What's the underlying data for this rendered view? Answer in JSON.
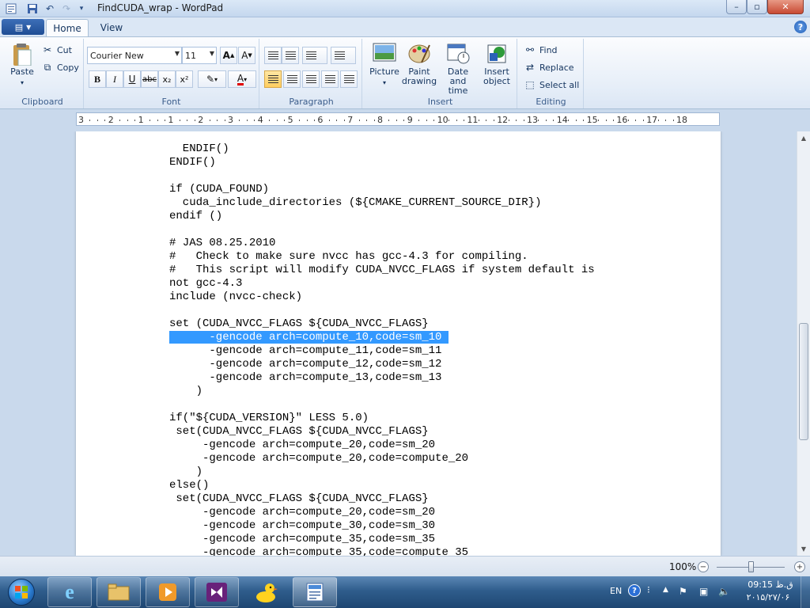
{
  "window": {
    "title": "FindCUDA_wrap - WordPad",
    "minimize": "–",
    "maximize": "▫",
    "close": "✕"
  },
  "tabs": {
    "home": "Home",
    "view": "View"
  },
  "ribbon": {
    "clipboard": {
      "label": "Clipboard",
      "paste": "Paste",
      "cut": "Cut",
      "copy": "Copy"
    },
    "font": {
      "label": "Font",
      "family": "Courier New",
      "size": "11",
      "bold": "B",
      "italic": "I",
      "underline": "U",
      "strike": "abc",
      "subscript": "x₂",
      "superscript": "x²"
    },
    "paragraph": {
      "label": "Paragraph"
    },
    "insert": {
      "label": "Insert",
      "picture": "Picture",
      "paint": "Paint drawing",
      "datetime": "Date and time",
      "object": "Insert object"
    },
    "editing": {
      "label": "Editing",
      "find": "Find",
      "replace": "Replace",
      "select_all": "Select all"
    }
  },
  "ruler": [
    "3",
    "2",
    "1",
    "1",
    "2",
    "3",
    "4",
    "5",
    "6",
    "7",
    "8",
    "9",
    "10",
    "11",
    "12",
    "13",
    "14",
    "15",
    "16",
    "17",
    "18"
  ],
  "document": {
    "lines": [
      "  ENDIF()",
      "ENDIF()",
      "",
      "if (CUDA_FOUND)",
      "  cuda_include_directories (${CMAKE_CURRENT_SOURCE_DIR})",
      "endif ()",
      "",
      "# JAS 08.25.2010",
      "#   Check to make sure nvcc has gcc-4.3 for compiling.",
      "#   This script will modify CUDA_NVCC_FLAGS if system default is",
      "not gcc-4.3",
      "include (nvcc-check)",
      "",
      "set (CUDA_NVCC_FLAGS ${CUDA_NVCC_FLAGS}",
      "      -gencode arch=compute_10,code=sm_10 ",
      "      -gencode arch=compute_11,code=sm_11",
      "      -gencode arch=compute_12,code=sm_12",
      "      -gencode arch=compute_13,code=sm_13",
      "    )",
      "",
      "if(\"${CUDA_VERSION}\" LESS 5.0)",
      " set(CUDA_NVCC_FLAGS ${CUDA_NVCC_FLAGS}",
      "     -gencode arch=compute_20,code=sm_20",
      "     -gencode arch=compute_20,code=compute_20",
      "    )",
      "else()",
      " set(CUDA_NVCC_FLAGS ${CUDA_NVCC_FLAGS}",
      "     -gencode arch=compute_20,code=sm_20",
      "     -gencode arch=compute_30,code=sm_30",
      "     -gencode arch=compute_35,code=sm_35",
      "     -gencode arch=compute_35,code=compute_35"
    ],
    "selected_line": 14
  },
  "statusbar": {
    "zoom": "100%",
    "zoom_out": "−",
    "zoom_in": "+"
  },
  "taskbar": {
    "lang": "EN",
    "time": "ق.ظ 09:15",
    "date": "۲۰۱۵/۲۷/۰۶"
  },
  "colors": {
    "selection": "#3399ff",
    "ribbon_bg": "#e6eef8",
    "taskbar": "#2f5d8c"
  }
}
